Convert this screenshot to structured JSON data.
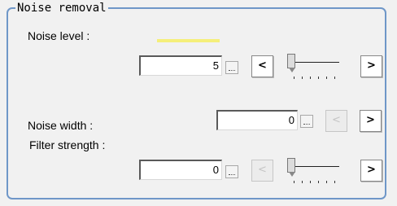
{
  "group": {
    "title": "Noise removal"
  },
  "noise_level": {
    "label": "Noise level :",
    "value": "5",
    "dots": "...",
    "dec": "<",
    "inc": ">",
    "slider_level": 0.0
  },
  "noise_width": {
    "label": "Noise width :",
    "value": "0",
    "dots": "...",
    "dec": "<",
    "inc": ">",
    "dec_enabled": false
  },
  "filter_strength": {
    "label": "Filter strength :",
    "value": "0",
    "dots": "...",
    "dec": "<",
    "inc": ">",
    "dec_enabled": false,
    "slider_level": 0.0
  },
  "colors": {
    "border": "#6f97c8",
    "indicator": "#f5ef7a"
  }
}
